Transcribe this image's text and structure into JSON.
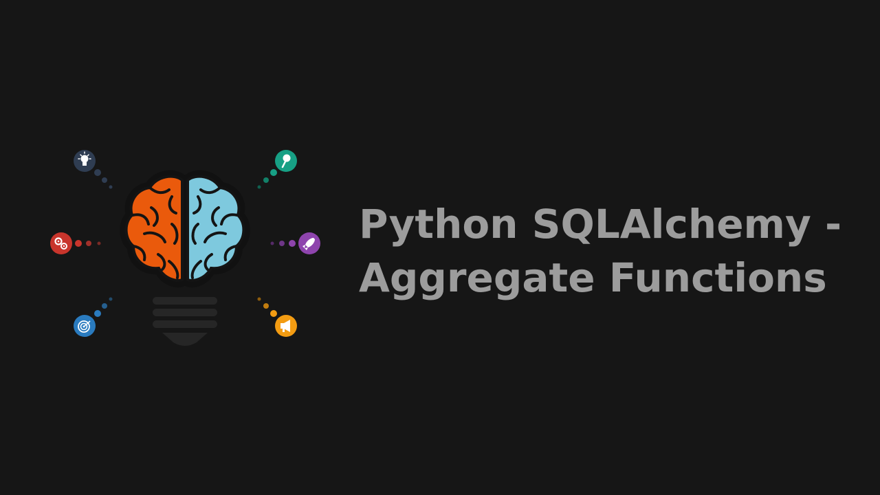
{
  "title": {
    "line1": "Python SQLAlchemy -",
    "line2": "Aggregate Functions"
  },
  "colors": {
    "background": "#161616",
    "title_text": "#9c9c9c",
    "brain_left": "#ea5a0c",
    "brain_right": "#7ec9de",
    "bulb_base": "#262626",
    "icon_lightbulb": "#2f3d52",
    "icon_gears": "#c8352c",
    "icon_target": "#2a7bbf",
    "icon_magnifier": "#17a085",
    "icon_rocket": "#8e44ad",
    "icon_megaphone": "#f39c12"
  },
  "icons": [
    "lightbulb-icon",
    "gears-icon",
    "target-icon",
    "magnifier-icon",
    "rocket-icon",
    "megaphone-icon"
  ]
}
